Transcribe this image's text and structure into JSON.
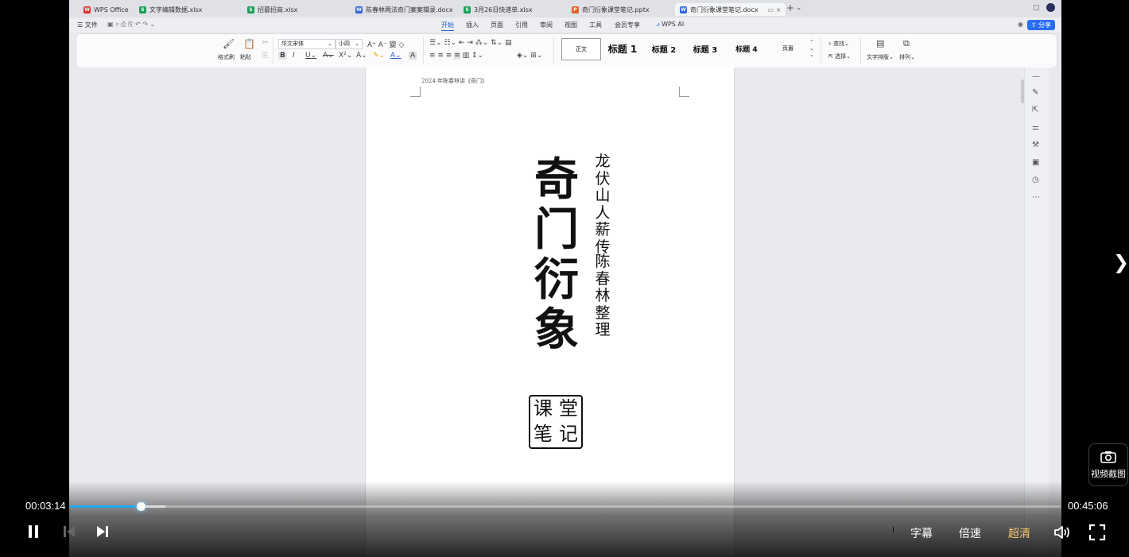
{
  "wps": {
    "tabs": [
      {
        "label": "WPS Office",
        "icon": "wps-logo-icon",
        "color": "#e0302b",
        "glyph": "W"
      },
      {
        "label": "文字编辑数据.xlsx",
        "icon": "spreadsheet-icon",
        "color": "#1e9d57",
        "glyph": "S"
      },
      {
        "label": "招募招商.xlsx",
        "icon": "spreadsheet-icon",
        "color": "#1e9d57",
        "glyph": "S"
      },
      {
        "label": "陈春林两法奇门案案辑录.docx",
        "icon": "document-icon",
        "color": "#2f64d6",
        "glyph": "W"
      },
      {
        "label": "3月26日快递单.xlsx",
        "icon": "spreadsheet-icon",
        "color": "#1e9d57",
        "glyph": "S"
      },
      {
        "label": "奇门衍象课堂笔记.pptx",
        "icon": "presentation-icon",
        "color": "#e0602b",
        "glyph": "P"
      },
      {
        "label": "奇门衍象课堂笔记.docx",
        "icon": "document-icon",
        "color": "#2f64d6",
        "glyph": "W"
      }
    ],
    "menu": {
      "file": "文件",
      "items": [
        "开始",
        "插入",
        "页面",
        "引用",
        "审阅",
        "视图",
        "工具",
        "会员专享"
      ],
      "ai": "WPS AI",
      "share": "分享"
    },
    "ribbon": {
      "format_painter": "格式刷",
      "paste": "粘贴",
      "font_name": "华文宋体",
      "font_size": "小四",
      "styles": [
        "正文",
        "标题 1",
        "标题 2",
        "标题 3",
        "标题 4",
        "页眉"
      ],
      "find": "查找",
      "select": "选择",
      "text_layout": "文字排版",
      "arrange": "排列"
    },
    "document": {
      "header": "2024 年陈春林讲《奇门》",
      "title": [
        "奇",
        "门",
        "衍",
        "象"
      ],
      "subtitle_col1": [
        "龙",
        "伏",
        "山",
        "人",
        "薪",
        "传"
      ],
      "subtitle_col2": [
        "陈",
        "春",
        "林",
        "整",
        "理"
      ],
      "seal": [
        "课",
        "堂",
        "笔",
        "记"
      ]
    }
  },
  "player": {
    "current_time": "00:03:14",
    "total_time": "00:45:06",
    "progress_fraction": 0.0717,
    "buffered_fraction": 0.096,
    "subtitle": "字幕",
    "speed": "倍速",
    "quality": "超清",
    "quality_color": "#f5c56a",
    "snapshot": "视频截图",
    "accent": "#1ea6f3"
  }
}
